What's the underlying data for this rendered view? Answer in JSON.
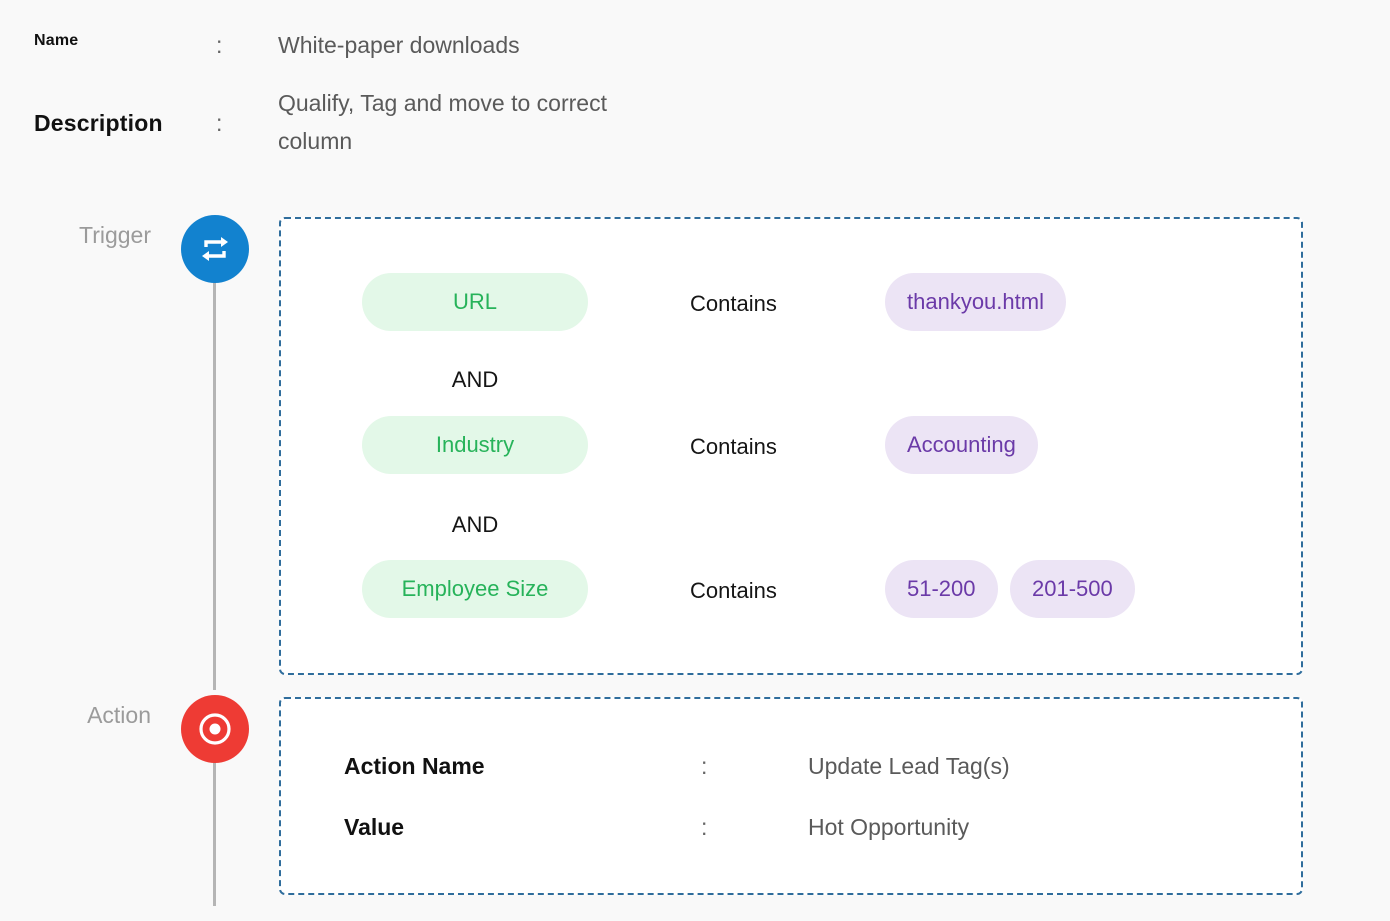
{
  "rule": {
    "name_label": "Name",
    "name_value": "White-paper downloads",
    "description_label": "Description",
    "description_value": "Qualify, Tag and move to correct column",
    "separator": ":"
  },
  "trigger": {
    "label": "Trigger",
    "icon": "repeat-arrows-icon",
    "color": "#1282cf",
    "conditions": [
      {
        "field": "URL",
        "operator": "Contains",
        "values": [
          "thankyou.html"
        ]
      },
      {
        "field": "Industry",
        "operator": "Contains",
        "values": [
          "Accounting"
        ]
      },
      {
        "field": "Employee Size",
        "operator": "Contains",
        "values": [
          "51-200",
          "201-500"
        ]
      }
    ],
    "conjunctions": [
      "AND",
      "AND"
    ]
  },
  "action": {
    "label": "Action",
    "icon": "target-icon",
    "color": "#ee3b34",
    "fields": [
      {
        "label": "Action Name",
        "value": "Update Lead Tag(s)"
      },
      {
        "label": "Value",
        "value": "Hot Opportunity"
      }
    ],
    "separator": ":"
  },
  "colors": {
    "field_pill_bg": "#e3f8e8",
    "field_pill_text": "#27b35a",
    "value_pill_bg": "#ece4f5",
    "value_pill_text": "#6b3aa8",
    "box_border": "#2f6d9c"
  }
}
